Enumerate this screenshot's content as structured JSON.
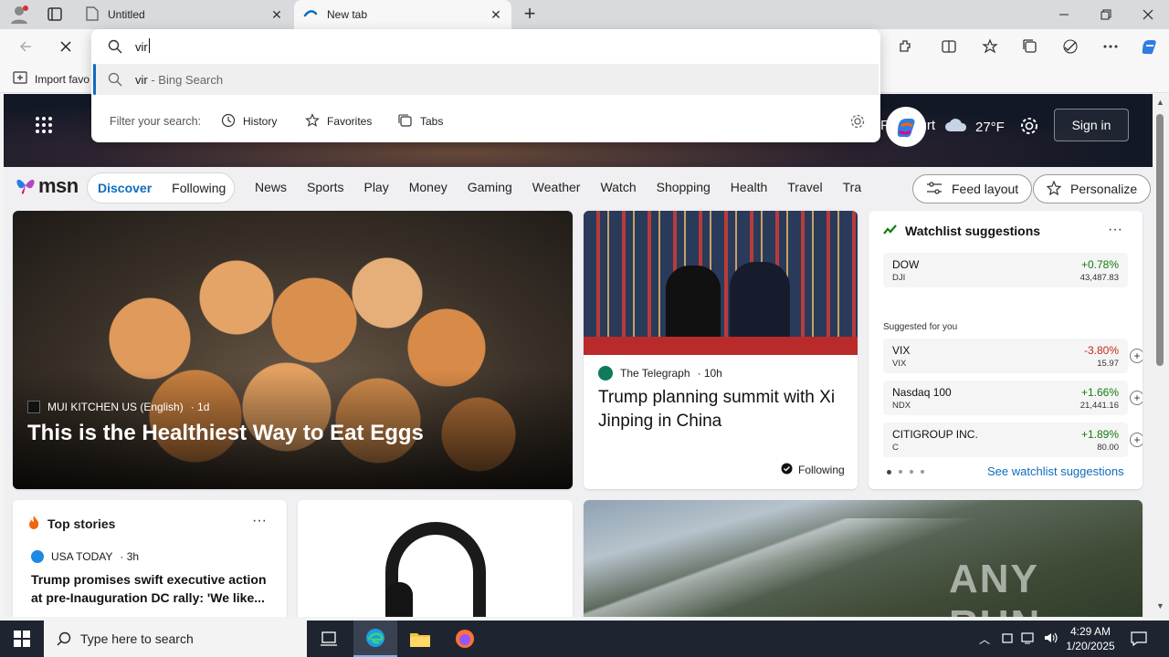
{
  "browser": {
    "tabs": [
      {
        "title": "Untitled"
      },
      {
        "title": "New tab"
      }
    ],
    "favorites_bar": {
      "import_label": "Import favo"
    }
  },
  "omnibox": {
    "value": "vir",
    "suggestion": {
      "query": "vir",
      "suffix": "- Bing Search"
    },
    "filter_label": "Filter your search:",
    "filters": [
      "History",
      "Favorites",
      "Tabs"
    ]
  },
  "msn": {
    "logo_text": "msn",
    "weather": {
      "location": "Frankfurt",
      "temp": "27°F"
    },
    "signin_label": "Sign in",
    "pills": [
      "Discover",
      "Following"
    ],
    "nav": [
      "News",
      "Sports",
      "Play",
      "Money",
      "Gaming",
      "Weather",
      "Watch",
      "Shopping",
      "Health",
      "Travel",
      "Tra"
    ],
    "feed_layout_label": "Feed layout",
    "personalize_label": "Personalize",
    "hero_card": {
      "source": "MUI KITCHEN US (English)",
      "age": "· 1d",
      "headline": "This is the Healthiest Way to Eat Eggs"
    },
    "news_card": {
      "source": "The Telegraph",
      "age": "· 10h",
      "headline": "Trump planning summit with Xi Jinping in China",
      "following_label": "Following"
    },
    "watchlist": {
      "title": "Watchlist suggestions",
      "main": {
        "name": "DOW",
        "symbol": "DJI",
        "change": "+0.78%",
        "price": "43,487.83"
      },
      "suggested_label": "Suggested for you",
      "items": [
        {
          "name": "VIX",
          "symbol": "VIX",
          "change": "-3.80%",
          "price": "15.97"
        },
        {
          "name": "Nasdaq 100",
          "symbol": "NDX",
          "change": "+1.66%",
          "price": "21,441.16"
        },
        {
          "name": "CITIGROUP INC.",
          "symbol": "C",
          "change": "+1.89%",
          "price": "80.00"
        }
      ],
      "see_all_label": "See watchlist suggestions"
    },
    "top_stories": {
      "title": "Top stories",
      "source": "USA TODAY",
      "age": "· 3h",
      "headline": "Trump promises swift executive action at pre-Inauguration DC rally: 'We like..."
    },
    "watermark": "ANY RUN"
  },
  "taskbar": {
    "search_placeholder": "Type here to search",
    "time": "4:29 AM",
    "date": "1/20/2025"
  },
  "colors": {
    "accent": "#0f6cbd",
    "positive": "#107c10",
    "negative": "#c42b1c",
    "taskbar": "#1f2530"
  }
}
